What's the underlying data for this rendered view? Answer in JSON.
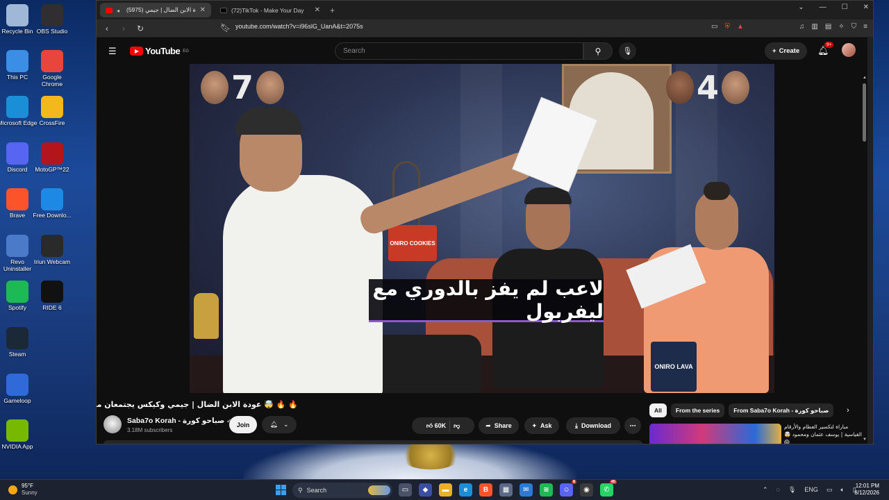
{
  "desktop": {
    "icons": [
      {
        "label": "Recycle Bin",
        "icon": "recycle-bin-icon",
        "color": "#9fb8d8"
      },
      {
        "label": "OBS Studio",
        "icon": "obs-icon",
        "color": "#302e31"
      },
      {
        "label": "This PC",
        "icon": "monitor-icon",
        "color": "#3a8ee6"
      },
      {
        "label": "Google Chrome",
        "icon": "chrome-icon",
        "color": "#e8453c"
      },
      {
        "label": "Microsoft Edge",
        "icon": "edge-icon",
        "color": "#1a8fd8"
      },
      {
        "label": "CrossFire",
        "icon": "crossfire-icon",
        "color": "#f2b81c"
      },
      {
        "label": "Discord",
        "icon": "discord-icon",
        "color": "#5865f2"
      },
      {
        "label": "MotoGP™22",
        "icon": "motogp-icon",
        "color": "#b4141c"
      },
      {
        "label": "Brave",
        "icon": "brave-icon",
        "color": "#fb542b"
      },
      {
        "label": "Free Downlo...",
        "icon": "download-manager-icon",
        "color": "#1e88e5"
      },
      {
        "label": "Revo Uninstaller",
        "icon": "revo-icon",
        "color": "#4a7ac8"
      },
      {
        "label": "Iriun Webcam",
        "icon": "webcam-icon",
        "color": "#2a2a2a"
      },
      {
        "label": "Spotify",
        "icon": "spotify-icon",
        "color": "#1db954"
      },
      {
        "label": "RIDE 6",
        "icon": "ride6-icon",
        "color": "#111111"
      },
      {
        "label": "Steam",
        "icon": "steam-icon",
        "color": "#1b2838"
      },
      {
        "label": "Gameloop",
        "icon": "gameloop-icon",
        "color": "#2f6ad8"
      },
      {
        "label": "NVIDIA App",
        "icon": "nvidia-icon",
        "color": "#76b900"
      }
    ]
  },
  "browser": {
    "tabs": [
      {
        "title": "(5975) عودة الابن الضال | جيمي...",
        "active": true,
        "favicon_color": "#ff0000"
      },
      {
        "title": "(72)TikTok - Make Your Day",
        "active": false,
        "favicon_color": "#111111"
      }
    ],
    "new_tab": "+",
    "url": "youtube.com/watch?v=i96slG_UanA&t=2075s"
  },
  "youtube": {
    "logo_text": "YouTube",
    "region": "EG",
    "search_placeholder": "Search",
    "create_label": "Create",
    "notifications_badge": "9+",
    "video": {
      "score_left": "7",
      "score_right": "4",
      "snack_label": "ONIRO COOKIES",
      "snack_label2": "ONIRO LAVA",
      "caption": "لاعب لم يفز بالدوري مع ليفربول"
    },
    "title": "🔥 🔥 🤯 عودة الابن الضال | جيمي وكيكس يجتمعان من جديد",
    "channel_name": "Saba7o Korah - صباحو كورة",
    "subscribers": "3.18M subscribers",
    "join_label": "Join",
    "likes": "60K",
    "share_label": "Share",
    "ask_label": "Ask",
    "download_label": "Download",
    "chips": [
      "All",
      "From the series",
      "From Saba7o Korah - صباحو كورة"
    ],
    "recommended_title": "مباراة لتكسير العظام والأرقام القياسية | يوسف عثمان ومحمود 🤯 😱"
  },
  "taskbar": {
    "temperature": "95°F",
    "weather_desc": "Sunny",
    "search_label": "Search",
    "language": "ENG",
    "time": "12:01 PM",
    "date": "8/12/2026",
    "discord_badge": "8",
    "whatsapp_badge": "45"
  }
}
